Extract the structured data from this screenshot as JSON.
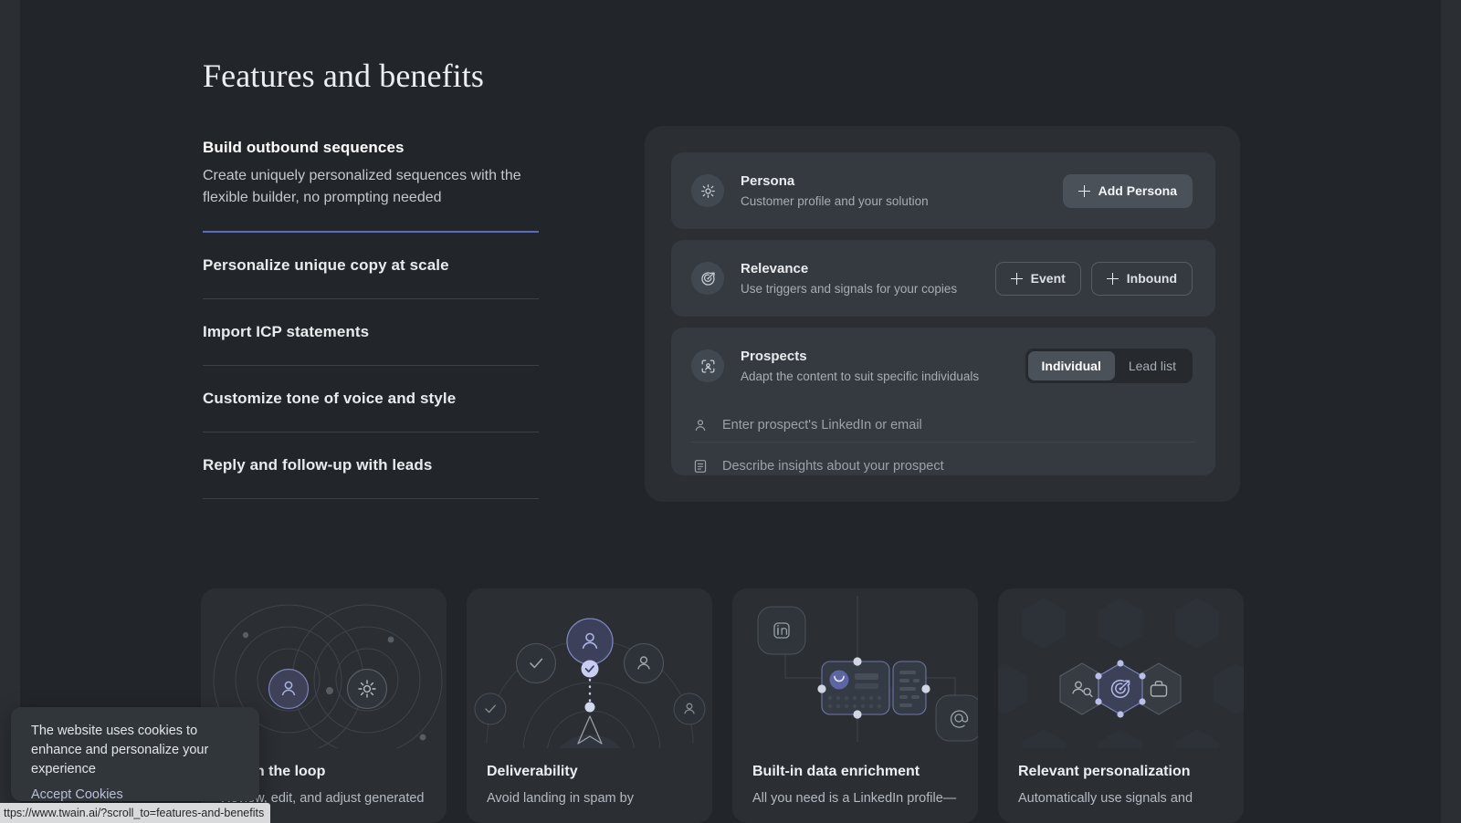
{
  "section": {
    "title": "Features and benefits"
  },
  "accordion": {
    "items": [
      {
        "heading": "Build outbound sequences",
        "body": "Create uniquely personalized sequences with the flexible builder, no prompting needed",
        "active": true
      },
      {
        "heading": "Personalize unique copy at scale",
        "body": "",
        "active": false
      },
      {
        "heading": "Import ICP statements",
        "body": "",
        "active": false
      },
      {
        "heading": "Customize tone of voice and style",
        "body": "",
        "active": false
      },
      {
        "heading": "Reply and follow-up with leads",
        "body": "",
        "active": false
      }
    ]
  },
  "demo": {
    "persona": {
      "icon": "crosshair-focus-icon",
      "title": "Persona",
      "subtitle": "Customer profile and your solution",
      "add_button": "Add Persona"
    },
    "relevance": {
      "icon": "target-arrow-icon",
      "title": "Relevance",
      "subtitle": "Use triggers and signals for your copies",
      "event_button": "Event",
      "inbound_button": "Inbound"
    },
    "prospects": {
      "icon": "person-scan-icon",
      "title": "Prospects",
      "subtitle": "Adapt the content to suit specific individuals",
      "toggle": {
        "options": [
          "Individual",
          "Lead list"
        ],
        "selected": "Individual"
      },
      "linkedin_placeholder": "Enter prospect's LinkedIn or email",
      "linkedin_icon": "person-icon",
      "insights_placeholder": "Describe insights about your prospect",
      "insights_icon": "note-document-icon"
    }
  },
  "features": [
    {
      "art": "orbit-rings-user-gear-art",
      "title": "You in the loop",
      "desc": "Review, edit, and adjust generated"
    },
    {
      "art": "deliverability-arc-send-art",
      "title": "Deliverability",
      "desc": "Avoid landing in spam by"
    },
    {
      "art": "data-enrichment-nodes-art",
      "title": "Built-in data enrichment",
      "desc": "All you need is a LinkedIn profile—"
    },
    {
      "art": "hexagon-grid-target-art",
      "title": "Relevant personalization",
      "desc": "Automatically use signals and"
    }
  ],
  "cookie_banner": {
    "message": "The website uses cookies to enhance and personalize your experience",
    "accept_label": "Accept Cookies"
  },
  "status_bar": {
    "url": "ttps://www.twain.ai/?scroll_to=features-and-benefits"
  },
  "colors": {
    "page_background": "#222529",
    "panel": "#2b2f34",
    "card": "#343a40",
    "accent": "#5a6cbe",
    "accent_light": "#9aa6e0",
    "text_primary": "#eceef1",
    "text_secondary": "#a7adb5"
  }
}
